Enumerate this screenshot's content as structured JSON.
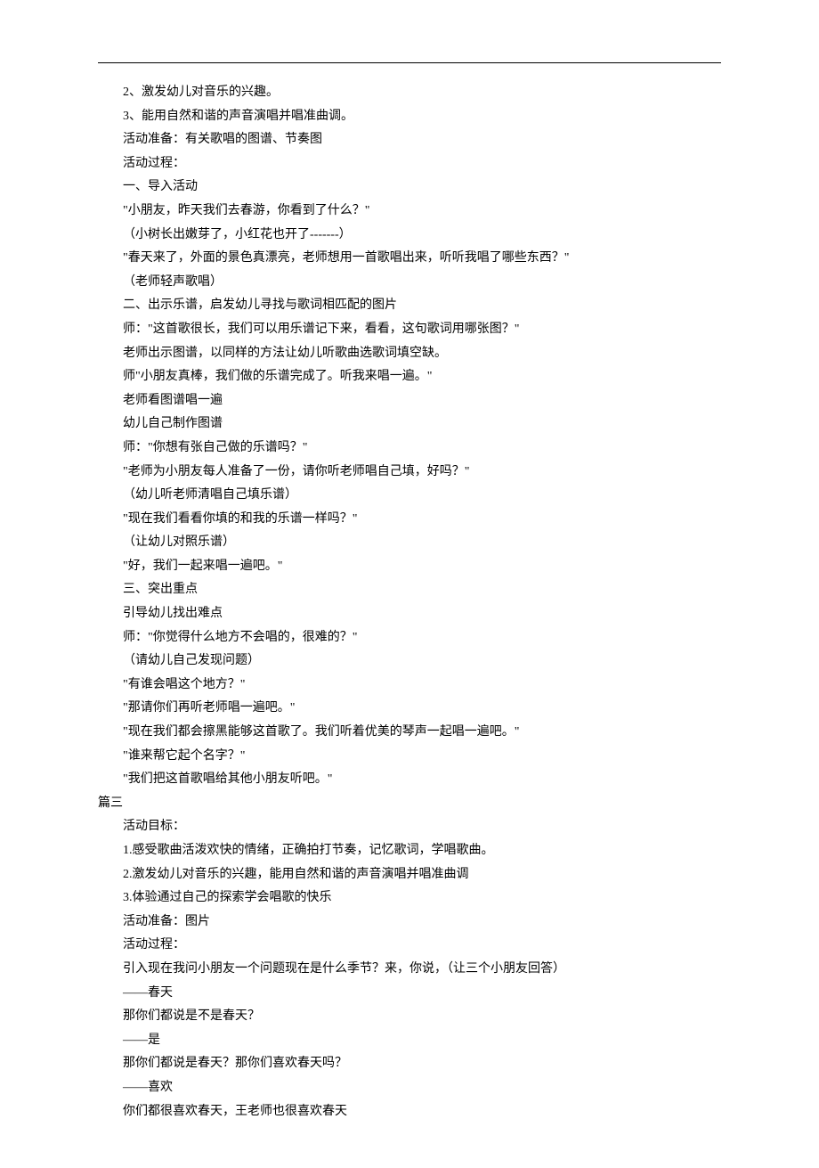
{
  "lines": [
    {
      "text": "2、激发幼儿对音乐的兴趣。",
      "indent": true
    },
    {
      "text": "3、能用自然和谐的声音演唱并唱准曲调。",
      "indent": true
    },
    {
      "text": "活动准备：有关歌唱的图谱、节奏图",
      "indent": true
    },
    {
      "text": "活动过程：",
      "indent": true
    },
    {
      "text": "一、导入活动",
      "indent": true
    },
    {
      "text": "\"小朋友，昨天我们去春游，你看到了什么？\"",
      "indent": true
    },
    {
      "text": "（小树长出嫩芽了，小红花也开了-------）",
      "indent": true
    },
    {
      "text": "\"春天来了，外面的景色真漂亮，老师想用一首歌唱出来，听听我唱了哪些东西？\"",
      "indent": true
    },
    {
      "text": "（老师轻声歌唱）",
      "indent": true
    },
    {
      "text": "二、出示乐谱，启发幼儿寻找与歌词相匹配的图片",
      "indent": true
    },
    {
      "text": "师：\"这首歌很长，我们可以用乐谱记下来，看看，这句歌词用哪张图？\"",
      "indent": true
    },
    {
      "text": "老师出示图谱，以同样的方法让幼儿听歌曲选歌词填空缺。",
      "indent": true
    },
    {
      "text": "师\"小朋友真棒，我们做的乐谱完成了。听我来唱一遍。\"",
      "indent": true
    },
    {
      "text": "老师看图谱唱一遍",
      "indent": true
    },
    {
      "text": "幼儿自己制作图谱",
      "indent": true
    },
    {
      "text": "师：\"你想有张自己做的乐谱吗？\"",
      "indent": true
    },
    {
      "text": "\"老师为小朋友每人准备了一份，请你听老师唱自己填，好吗？\"",
      "indent": true
    },
    {
      "text": "（幼儿听老师清唱自己填乐谱）",
      "indent": true
    },
    {
      "text": "\"现在我们看看你填的和我的乐谱一样吗？\"",
      "indent": true
    },
    {
      "text": "（让幼儿对照乐谱）",
      "indent": true
    },
    {
      "text": "\"好，我们一起来唱一遍吧。\"",
      "indent": true
    },
    {
      "text": "三、突出重点",
      "indent": true
    },
    {
      "text": "引导幼儿找出难点",
      "indent": true
    },
    {
      "text": "师：\"你觉得什么地方不会唱的，很难的？\"",
      "indent": true
    },
    {
      "text": "（请幼儿自己发现问题）",
      "indent": true
    },
    {
      "text": "\"有谁会唱这个地方？\"",
      "indent": true
    },
    {
      "text": "\"那请你们再听老师唱一遍吧。\"",
      "indent": true
    },
    {
      "text": "\"现在我们都会擦黑能够这首歌了。我们听着优美的琴声一起唱一遍吧。\"",
      "indent": true
    },
    {
      "text": "\"谁来帮它起个名字？\"",
      "indent": true
    },
    {
      "text": "\"我们把这首歌唱给其他小朋友听吧。\"",
      "indent": true
    },
    {
      "text": "篇三",
      "indent": false
    },
    {
      "text": "活动目标：",
      "indent": true
    },
    {
      "text": "1.感受歌曲活泼欢快的情绪，正确拍打节奏，记忆歌词，学唱歌曲。",
      "indent": true
    },
    {
      "text": "2.激发幼儿对音乐的兴趣，能用自然和谐的声音演唱并唱准曲调",
      "indent": true
    },
    {
      "text": "3.体验通过自己的探索学会唱歌的快乐",
      "indent": true
    },
    {
      "text": "活动准备：图片",
      "indent": true
    },
    {
      "text": "活动过程：",
      "indent": true
    },
    {
      "text": "引入现在我问小朋友一个问题现在是什么季节？来，你说，（让三个小朋友回答）",
      "indent": true
    },
    {
      "text": "——春天",
      "indent": true
    },
    {
      "text": "那你们都说是不是春天？",
      "indent": true
    },
    {
      "text": "——是",
      "indent": true
    },
    {
      "text": "那你们都说是春天？那你们喜欢春天吗？",
      "indent": true
    },
    {
      "text": "——喜欢",
      "indent": true
    },
    {
      "text": "你们都很喜欢春天，王老师也很喜欢春天",
      "indent": true
    }
  ]
}
